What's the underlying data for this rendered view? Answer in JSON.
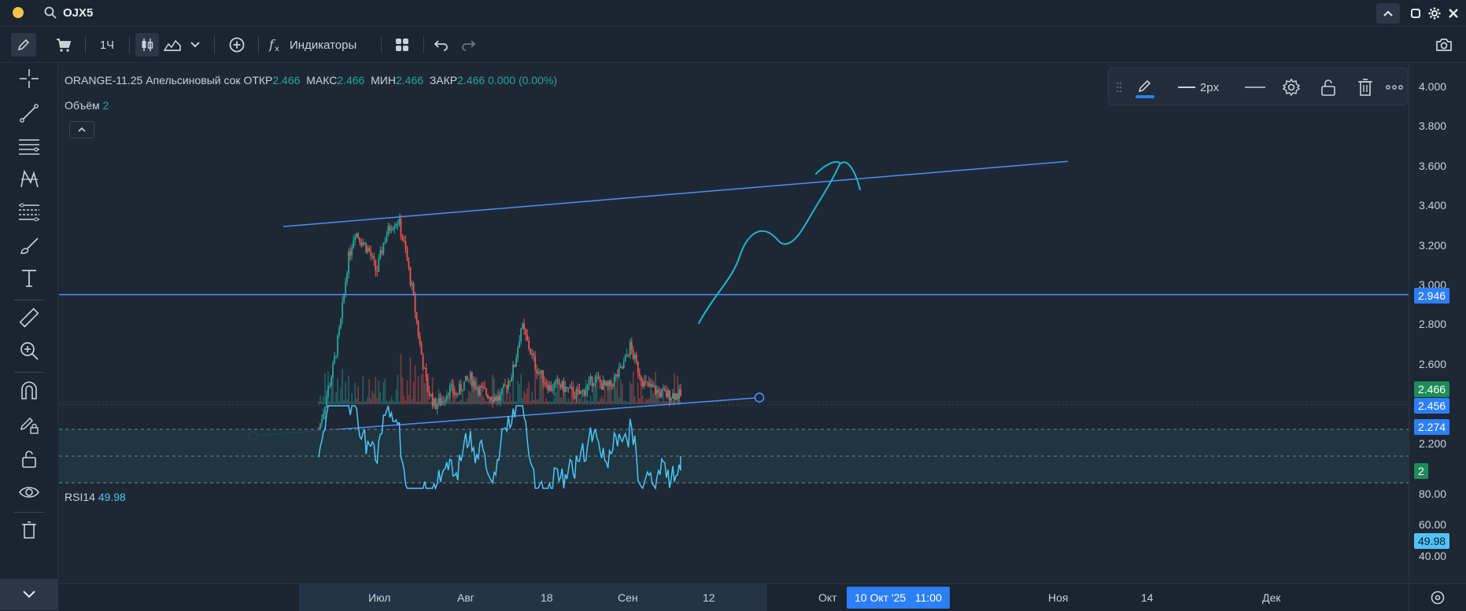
{
  "titlebar": {
    "ticker": "OJX5"
  },
  "toolbar": {
    "interval": "1Ч",
    "indicators_label": "Индикаторы"
  },
  "legend": {
    "symbol": "ORANGE-11.25 Апельсиновый сок",
    "open_label": "ОТКР",
    "open": "2.466",
    "high_label": "МАКС",
    "high": "2.466",
    "low_label": "МИН",
    "low": "2.466",
    "close_label": "ЗАКР",
    "close": "2.466",
    "change": "0.000 (0.00%)"
  },
  "volume": {
    "label": "Объём",
    "value": "2"
  },
  "rsi": {
    "label": "RSI14",
    "value": "49.98",
    "scale": [
      "80.00",
      "60.00",
      "40.00"
    ]
  },
  "drawbar": {
    "width_label": "2px"
  },
  "price_axis": {
    "labels": [
      "4.000",
      "3.800",
      "3.600",
      "3.400",
      "3.200",
      "3.000",
      "2.800",
      "2.600",
      "2.200"
    ],
    "tag_hline": "2.946",
    "tag_last": "2.466",
    "tag_trend1": "2.456",
    "tag_trend2": "2.274",
    "tag_volume": "2",
    "tag_rsi": "49.98"
  },
  "time_axis": {
    "labels": [
      "Июл",
      "Авг",
      "18",
      "Сен",
      "12",
      "Окт",
      "Ноя",
      "14",
      "Дек"
    ],
    "cursor_date": "10 Окт '25",
    "cursor_time": "11:00"
  },
  "colors": {
    "up": "#26a69a",
    "down": "#ef5350",
    "line": "#4d8df7",
    "brush": "#1fb5c9",
    "rsi": "#4fc3f7",
    "tag_blue": "#2d7ff9",
    "tag_green": "#1e8c5a"
  },
  "chart_data": {
    "type": "candlestick",
    "price_range": [
      2.2,
      4.0
    ],
    "candles_close": [
      2.3,
      2.45,
      2.6,
      2.8,
      3.1,
      3.25,
      3.2,
      3.15,
      3.05,
      3.2,
      3.28,
      3.3,
      3.15,
      2.95,
      2.7,
      2.5,
      2.42,
      2.44,
      2.5,
      2.47,
      2.52,
      2.55,
      2.5,
      2.48,
      2.46,
      2.45,
      2.52,
      2.6,
      2.8,
      2.7,
      2.6,
      2.55,
      2.5,
      2.52,
      2.5,
      2.48,
      2.47,
      2.5,
      2.55,
      2.52,
      2.5,
      2.55,
      2.6,
      2.7,
      2.6,
      2.52,
      2.5,
      2.48,
      2.47,
      2.47,
      2.466
    ],
    "hline_price": 2.946,
    "trend_upper": [
      [
        3.27,
        3.58
      ]
    ],
    "trend_lower": [
      [
        2.274,
        2.456
      ]
    ],
    "rsi_range": [
      20,
      100
    ],
    "rsi_last": 49.98
  }
}
